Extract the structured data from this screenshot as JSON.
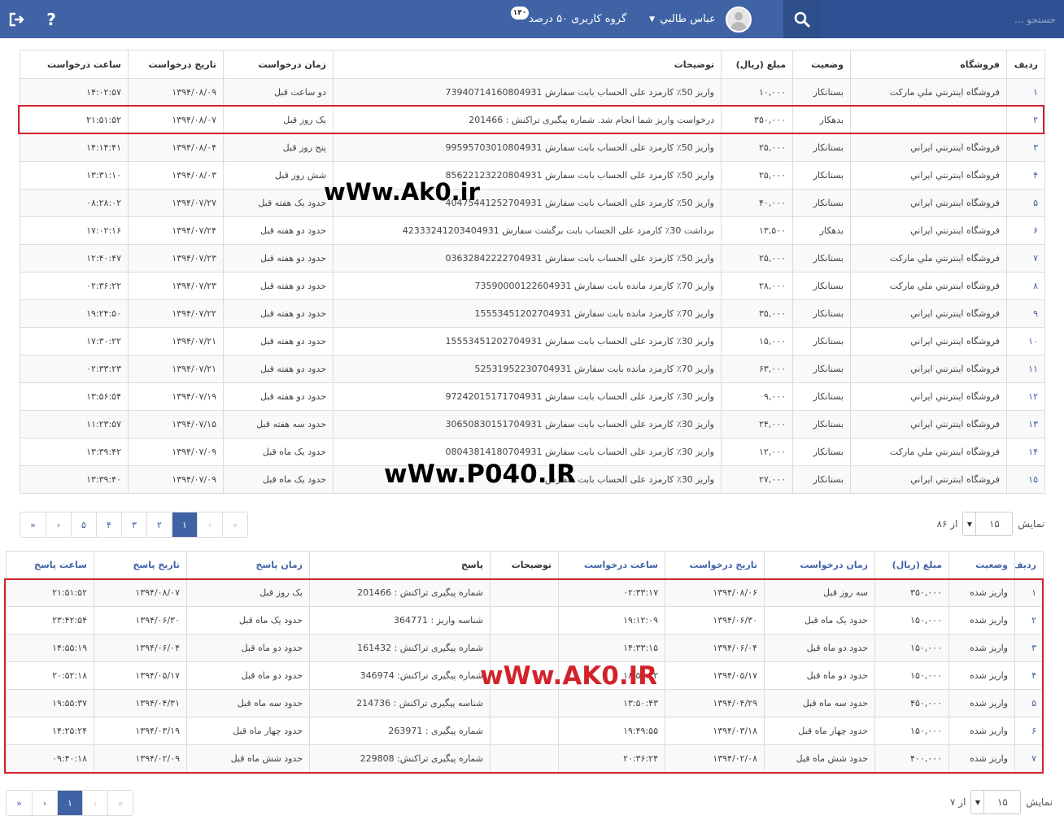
{
  "topbar": {
    "search_placeholder": "جستجو ...",
    "user_name": "عباس طالبي",
    "group_label": "گروه کاربری ۵۰ درصد",
    "group_badge": "۱۴۰",
    "help_label": "?",
    "bg_color": "#3f63a5"
  },
  "icons": {
    "logout": "logout-icon",
    "help": "help-icon",
    "search": "search-icon",
    "caret": "caret-down-icon",
    "avatar": "user-avatar"
  },
  "requests_table": {
    "headers": [
      "ردیف",
      "فروشگاه",
      "وضعیت",
      "مبلغ (ریال)",
      "توضیحات",
      "زمان درخواست",
      "تاریخ درخواست",
      "ساعت درخواست"
    ],
    "rows": [
      [
        "۱",
        "فروشگاه اينترنتي ملي مارکت",
        "بستانکار",
        "۱۰,۰۰۰",
        "واریز 50٪ کارمزد علی الحساب بابت سفارش 73940714160804931",
        "دو ساعت قبل",
        "۱۳۹۴/۰۸/۰۹",
        "۱۴:۰۲:۵۷"
      ],
      [
        "۲",
        "",
        "بدهکار",
        "۳۵۰,۰۰۰",
        "درخواست واریز شما انجام شد. شماره پیگیری تراکنش : 201466",
        "یک روز قبل",
        "۱۳۹۴/۰۸/۰۷",
        "۲۱:۵۱:۵۲"
      ],
      [
        "۳",
        "فروشگاه اينترنتي ايراني",
        "بستانکار",
        "۲۵,۰۰۰",
        "واریز 50٪ کارمزد علی الحساب بابت سفارش 99595703010804931",
        "پنج روز قبل",
        "۱۳۹۴/۰۸/۰۴",
        "۱۴:۱۴:۴۱"
      ],
      [
        "۴",
        "فروشگاه اينترنتي ايراني",
        "بستانکار",
        "۲۵,۰۰۰",
        "واریز 50٪ کارمزد علی الحساب بابت سفارش 85622123220804931",
        "شش روز قبل",
        "۱۳۹۴/۰۸/۰۳",
        "۱۳:۳۱:۱۰"
      ],
      [
        "۵",
        "فروشگاه اينترنتي ايراني",
        "بستانکار",
        "۴۰,۰۰۰",
        "واریز 50٪ کارمزد علی الحساب بابت سفارش 40475441252704931",
        "حدود یک هفته قبل",
        "۱۳۹۴/۰۷/۲۷",
        "۰۸:۲۸:۰۲"
      ],
      [
        "۶",
        "فروشگاه اينترنتي ايراني",
        "بدهکار",
        "۱۳,۵۰۰",
        "برداشت 30٪ کارمزد علی الحساب بابت برگشت سفارش 42333241203404931",
        "حدود دو هفته قبل",
        "۱۳۹۴/۰۷/۲۴",
        "۱۷:۰۲:۱۶"
      ],
      [
        "۷",
        "فروشگاه اينترنتي ملي مارکت",
        "بستانکار",
        "۲۵,۰۰۰",
        "واریز 50٪ کارمزد علی الحساب بابت سفارش 03632842222704931",
        "حدود دو هفته قبل",
        "۱۳۹۴/۰۷/۲۳",
        "۱۲:۴۰:۴۷"
      ],
      [
        "۸",
        "فروشگاه اينترنتي ملي مارکت",
        "بستانکار",
        "۲۸,۰۰۰",
        "واریز 70٪ کارمزد مانده بابت سفارش 73590000122604931",
        "حدود دو هفته قبل",
        "۱۳۹۴/۰۷/۲۳",
        "۰۲:۳۶:۲۲"
      ],
      [
        "۹",
        "فروشگاه اينترنتي ايراني",
        "بستانکار",
        "۳۵,۰۰۰",
        "واریز 70٪ کارمزد مانده بابت سفارش 15553451202704931",
        "حدود دو هفته قبل",
        "۱۳۹۴/۰۷/۲۲",
        "۱۹:۲۴:۵۰"
      ],
      [
        "۱۰",
        "فروشگاه اينترنتي ايراني",
        "بستانکار",
        "۱۵,۰۰۰",
        "واریز 30٪ کارمزد علی الحساب بابت سفارش 15553451202704931",
        "حدود دو هفته قبل",
        "۱۳۹۴/۰۷/۲۱",
        "۱۷:۳۰:۲۲"
      ],
      [
        "۱۱",
        "فروشگاه اينترنتي ايراني",
        "بستانکار",
        "۶۳,۰۰۰",
        "واریز 70٪ کارمزد مانده بابت سفارش 52531952230704931",
        "حدود دو هفته قبل",
        "۱۳۹۴/۰۷/۲۱",
        "۰۲:۳۳:۲۳"
      ],
      [
        "۱۲",
        "فروشگاه اينترنتي ايراني",
        "بستانکار",
        "۹,۰۰۰",
        "واریز 30٪ کارمزد علی الحساب بابت سفارش 97242015171704931",
        "حدود دو هفته قبل",
        "۱۳۹۴/۰۷/۱۹",
        "۱۳:۵۶:۵۴"
      ],
      [
        "۱۳",
        "فروشگاه اينترنتي ايراني",
        "بستانکار",
        "۲۴,۰۰۰",
        "واریز 30٪ کارمزد علی الحساب بابت سفارش 30650830151704931",
        "حدود سه هفته قبل",
        "۱۳۹۴/۰۷/۱۵",
        "۱۱:۲۳:۵۷"
      ],
      [
        "۱۴",
        "فروشگاه اينترنتي ملي مارکت",
        "بستانکار",
        "۱۲,۰۰۰",
        "واریز 30٪ کارمزد علی الحساب بابت سفارش 08043814180704931",
        "حدود یک ماه قبل",
        "۱۳۹۴/۰۷/۰۹",
        "۱۳:۳۹:۴۲"
      ],
      [
        "۱۵",
        "فروشگاه اينترنتي ايراني",
        "بستانکار",
        "۲۷,۰۰۰",
        "واریز 30٪ کارمزد علی الحساب بابت سفارش",
        "حدود یک ماه قبل",
        "۱۳۹۴/۰۷/۰۹",
        "۱۳:۳۹:۴۰"
      ]
    ]
  },
  "pager1": {
    "first": "«",
    "prev": "‹",
    "pages": [
      "۱",
      "۲",
      "۳",
      "۴",
      "۵"
    ],
    "next": "›",
    "last": "»",
    "active": "۱"
  },
  "show1": {
    "label": "نمایش",
    "value": "۱۵",
    "of": "از ۸۶"
  },
  "payouts_table": {
    "headers": [
      "ردیف",
      "وضعیت",
      "مبلغ (ریال)",
      "زمان درخواست",
      "تاریخ درخواست",
      "ساعت درخواست",
      "توضیحات",
      "پاسخ",
      "زمان پاسخ",
      "تاریخ پاسخ",
      "ساعت پاسخ"
    ],
    "rows": [
      [
        "۱",
        "واریز شده",
        "۳۵۰,۰۰۰",
        "سه روز قبل",
        "۱۳۹۴/۰۸/۰۶",
        "۰۲:۳۳:۱۷",
        "",
        "شماره پیگیری تراکنش : 201466",
        "یک روز قبل",
        "۱۳۹۴/۰۸/۰۷",
        "۲۱:۵۱:۵۲"
      ],
      [
        "۲",
        "واریز شده",
        "۱۵۰,۰۰۰",
        "حدود یک ماه قبل",
        "۱۳۹۴/۰۶/۳۰",
        "۱۹:۱۲:۰۹",
        "",
        "شناسه واریز : 364771",
        "حدود یک ماه قبل",
        "۱۳۹۴/۰۶/۳۰",
        "۲۳:۴۲:۵۴"
      ],
      [
        "۳",
        "واریز شده",
        "۱۵۰,۰۰۰",
        "حدود دو ماه قبل",
        "۱۳۹۴/۰۶/۰۴",
        "۱۴:۳۳:۱۵",
        "",
        "شماره پیگیری تراکنش : 161432",
        "حدود دو ماه قبل",
        "۱۳۹۴/۰۶/۰۴",
        "۱۴:۵۵:۱۹"
      ],
      [
        "۴",
        "واریز شده",
        "۱۵۰,۰۰۰",
        "حدود دو ماه قبل",
        "۱۳۹۴/۰۵/۱۷",
        "۱۸:۵۰:۴۲",
        "",
        "شماره پیگیری تراکنش: 346974",
        "حدود دو ماه قبل",
        "۱۳۹۴/۰۵/۱۷",
        "۲۰:۵۲:۱۸"
      ],
      [
        "۵",
        "واریز شده",
        "۴۵۰,۰۰۰",
        "حدود سه ماه قبل",
        "۱۳۹۴/۰۴/۲۹",
        "۱۳:۵۰:۴۳",
        "",
        "شناسه پیگیری تراکنش : 214736",
        "حدود سه ماه قبل",
        "۱۳۹۴/۰۴/۳۱",
        "۱۹:۵۵:۳۷"
      ],
      [
        "۶",
        "واریز شده",
        "۱۵۰,۰۰۰",
        "حدود چهار ماه قبل",
        "۱۳۹۴/۰۳/۱۸",
        "۱۹:۴۹:۵۵",
        "",
        "شماره پیگیری : 263971",
        "حدود چهار ماه قبل",
        "۱۳۹۴/۰۳/۱۹",
        "۱۴:۲۵:۲۴"
      ],
      [
        "۷",
        "واریز شده",
        "۴۰۰,۰۰۰",
        "حدود شش ماه قبل",
        "۱۳۹۴/۰۲/۰۸",
        "۲۰:۳۶:۲۴",
        "",
        "شماره پیگیری تراکنش: 229808",
        "حدود شش ماه قبل",
        "۱۳۹۴/۰۲/۰۹",
        "۰۹:۴۰:۱۸"
      ]
    ]
  },
  "pager2": {
    "first": "«",
    "prev": "‹",
    "pages": [
      "۱"
    ],
    "next": "›",
    "last": "»",
    "active": "۱"
  },
  "show2": {
    "label": "نمایش",
    "value": "۱۵",
    "of": "از ۷"
  },
  "watermarks": [
    "wWw.Ak0.ir",
    "wWw.P040.IR",
    "wWw.AK0.IR"
  ],
  "highlight_color": "#d2232a"
}
